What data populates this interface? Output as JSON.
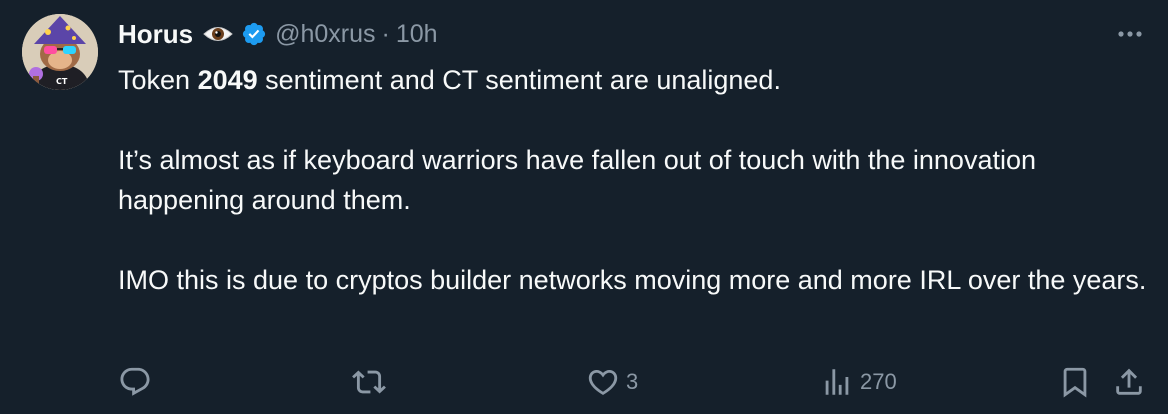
{
  "tweet": {
    "author": {
      "name": "Horus",
      "handle": "@h0xrus",
      "verified": true,
      "emoji_icon": "eye-icon",
      "avatar_icon": "wizard-monkey-avatar"
    },
    "separator": "·",
    "time": "10h",
    "body": {
      "p1_before": "Token ",
      "p1_bold": "2049",
      "p1_after": " sentiment and CT sentiment are unaligned.",
      "p2": "It’s almost as if keyboard warriors have fallen out of touch with the innovation happening around them.",
      "p3": "IMO this is due to cryptos builder networks moving more and more IRL over the years."
    },
    "actions": {
      "replies": "",
      "retweets": "",
      "likes": "3",
      "views": "270"
    }
  },
  "colors": {
    "background": "#15202b",
    "text": "#f7f9f9",
    "secondary": "#8b98a5",
    "verified": "#1d9bf0"
  }
}
